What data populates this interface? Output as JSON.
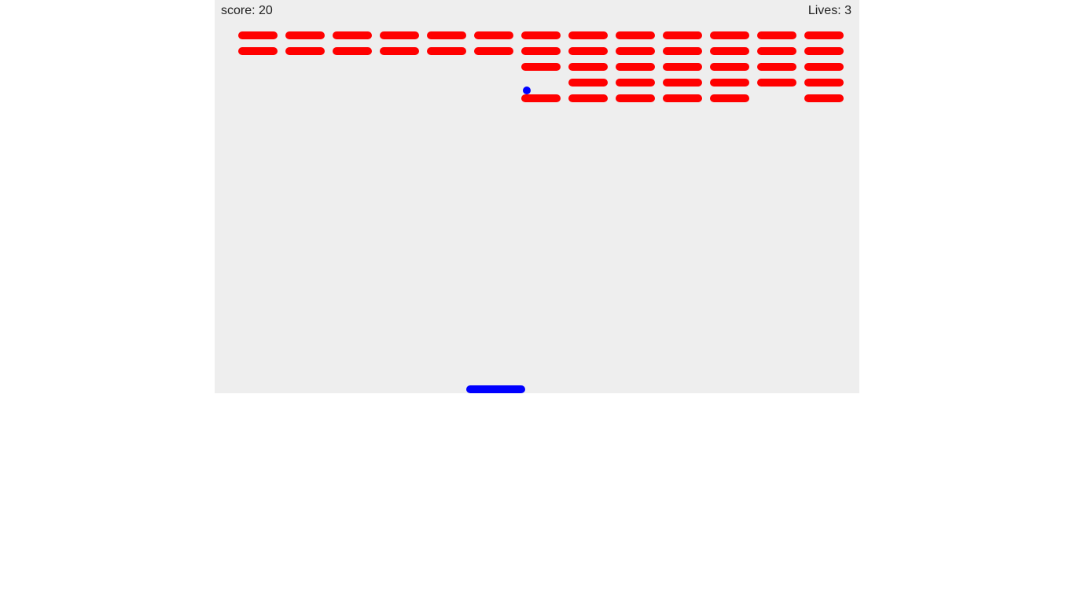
{
  "hud": {
    "score_label": "score:",
    "score_value": "20",
    "lives_label": "Lives:",
    "lives_value": "3"
  },
  "colors": {
    "background": "#ffffff",
    "playfield": "#eeeeee",
    "brick": "#ff0000",
    "ball": "#0000ff",
    "paddle": "#0000ff",
    "hud_text": "#222222"
  },
  "bricks": {
    "columns": 13,
    "rows": 5,
    "remaining": [
      [
        1,
        1,
        1,
        1,
        1,
        1,
        1,
        1,
        1,
        1,
        1,
        1,
        1
      ],
      [
        1,
        1,
        1,
        1,
        1,
        1,
        1,
        1,
        1,
        1,
        1,
        1,
        1
      ],
      [
        0,
        0,
        0,
        0,
        0,
        0,
        1,
        1,
        1,
        1,
        1,
        1,
        1
      ],
      [
        0,
        0,
        0,
        0,
        0,
        0,
        0,
        1,
        1,
        1,
        1,
        1,
        1
      ],
      [
        0,
        0,
        0,
        0,
        0,
        0,
        1,
        1,
        1,
        1,
        1,
        0,
        1
      ]
    ]
  }
}
